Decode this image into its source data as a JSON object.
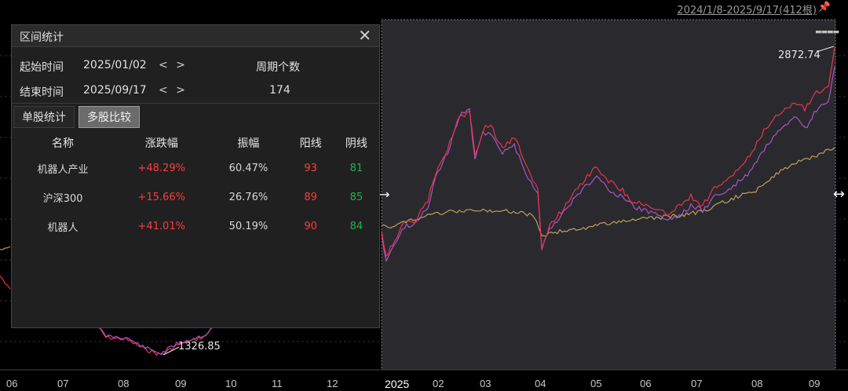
{
  "header": {
    "range": "2024/1/8-2025/9/17(412根)"
  },
  "panel": {
    "title": "区间统计",
    "start_label": "起始时间",
    "start_value": "2025/01/02",
    "end_label": "结束时间",
    "end_value": "2025/09/17",
    "nav": "< >",
    "period_label": "周期个数",
    "period_value": "174",
    "tabs": [
      "单股统计",
      "多股比较"
    ],
    "columns": [
      "名称",
      "涨跌幅",
      "振幅",
      "阳线",
      "阴线"
    ],
    "rows": [
      {
        "name": "机器人产业",
        "change": "+48.29%",
        "amplitude": "60.47%",
        "up": "93",
        "down": "81"
      },
      {
        "name": "沪深300",
        "change": "+15.66%",
        "amplitude": "26.76%",
        "up": "89",
        "down": "85"
      },
      {
        "name": "机器人",
        "change": "+41.01%",
        "amplitude": "50.19%",
        "up": "90",
        "down": "84"
      }
    ]
  },
  "chart": {
    "low_label": "1326.85",
    "high_label": "2872.74",
    "xticks": [
      "06",
      "07",
      "08",
      "09",
      "10",
      "11",
      "12",
      "2025",
      "02",
      "03",
      "04",
      "05",
      "06",
      "07",
      "08",
      "09"
    ],
    "colors": {
      "red": "#e8344e",
      "purple": "#a855c8",
      "gold": "#b9a15a",
      "selection": "#2b2b2f"
    }
  }
}
